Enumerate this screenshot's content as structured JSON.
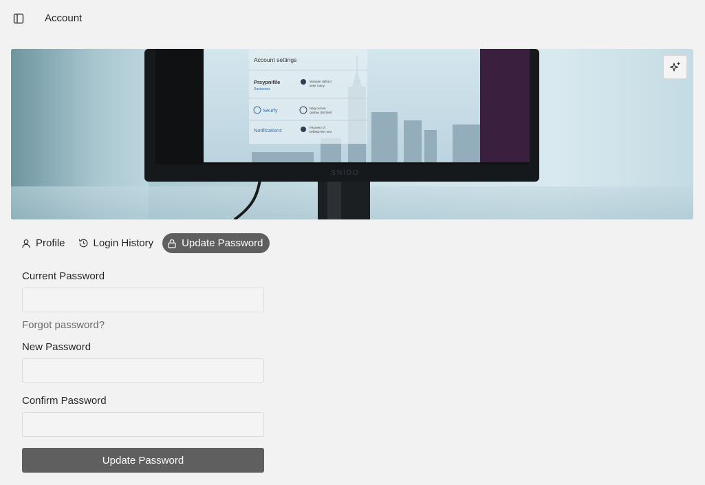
{
  "header": {
    "title": "Account",
    "sidebar_toggle_icon": "sidebar-panel-icon"
  },
  "banner": {
    "screen_heading": "Account settings",
    "screen_rows": [
      {
        "label": "Prsypnifile",
        "sublabel": "Rashvotes",
        "detail_line1": "Wanater defract",
        "detail_line2": "setyr mony"
      },
      {
        "label": "Seurfy",
        "detail_line1": "Nsig cenvot",
        "detail_line2": "opdrep dixt bisst"
      },
      {
        "label": "Notifications",
        "detail_line1": "Pasmerv of",
        "detail_line2": "belfasp hier rest"
      }
    ],
    "monitor_brand": "SNIDO",
    "ai_button_icon": "sparkles-icon"
  },
  "tabs": [
    {
      "label": "Profile",
      "icon": "user-icon",
      "active": false
    },
    {
      "label": "Login History",
      "icon": "history-icon",
      "active": false
    },
    {
      "label": "Update Password",
      "icon": "lock-icon",
      "active": true
    }
  ],
  "form": {
    "current_password_label": "Current Password",
    "current_password_value": "",
    "forgot_password_link": "Forgot password?",
    "new_password_label": "New Password",
    "new_password_value": "",
    "confirm_password_label": "Confirm Password",
    "confirm_password_value": "",
    "submit_label": "Update Password"
  },
  "colors": {
    "background": "#f2f2f2",
    "active_tab": "#5f5f5f",
    "submit_button": "#5f5f5f",
    "link": "#6a6a6a"
  }
}
